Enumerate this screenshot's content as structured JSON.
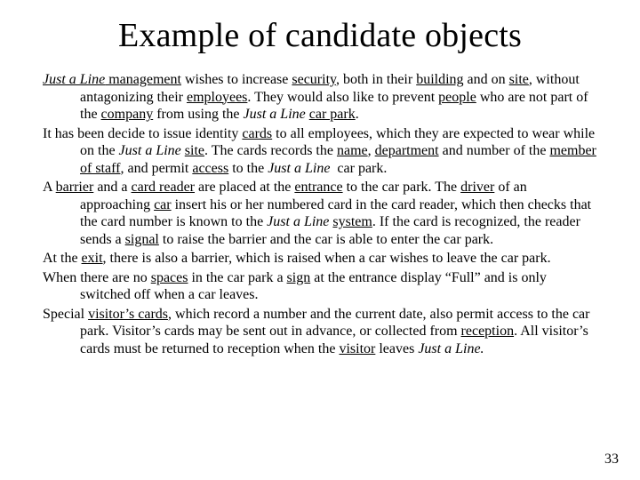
{
  "title": "Example of candidate objects",
  "page_number": "33",
  "paragraphs": {
    "p1": "<u><em class=\"co\">Just a Line</em> management</u> wishes to increase <u>security</u>, both in their <u>building</u> and on <u>site</u>, without antagonizing their <u>employees</u>. They would also like to prevent <u>people</u> who are not part of the <u>company</u> from using the <em class=\"co\">Just a Line</em> <u>car park</u>.",
    "p2": "It has been decide to issue identity <u>cards</u> to all employees, which they are expected to wear while on the <em class=\"co\">Just a Line</em> <u>site</u>. The cards records the <u>name</u>, <u>department</u> and number of the <u>member of staff</u>, and permit <u>access</u> to the <em class=\"co\">Just a Line</em>&nbsp; car park.",
    "p3": "A <u>barrier</u> and a <u>card reader</u> are placed at the <u>entrance</u> to the car park. The <u>driver</u> of an approaching <u>car</u> insert his or her numbered card in the card reader, which then checks that the card number is known to the <em class=\"co\">Just a Line</em> <u>system</u>. If the card is recognized, the reader sends a <u>signal</u> to raise the barrier and the car is able to enter the car park.",
    "p4": "At the <u>exit</u>, there is also a barrier, which is raised when a car wishes to leave the car park.",
    "p5": "When there are no <u>spaces</u> in the car park a <u>sign</u> at the entrance display “Full” and is only switched off when a car leaves.",
    "p6": "Special <u>visitor’s cards</u>, which record a number and the current date, also permit access to the car park. Visitor’s cards may be sent out in advance, or collected from <u>reception</u>. All visitor’s cards must be returned to reception when the <u>visitor</u> leaves <em class=\"co\">Just a Line.</em>"
  }
}
